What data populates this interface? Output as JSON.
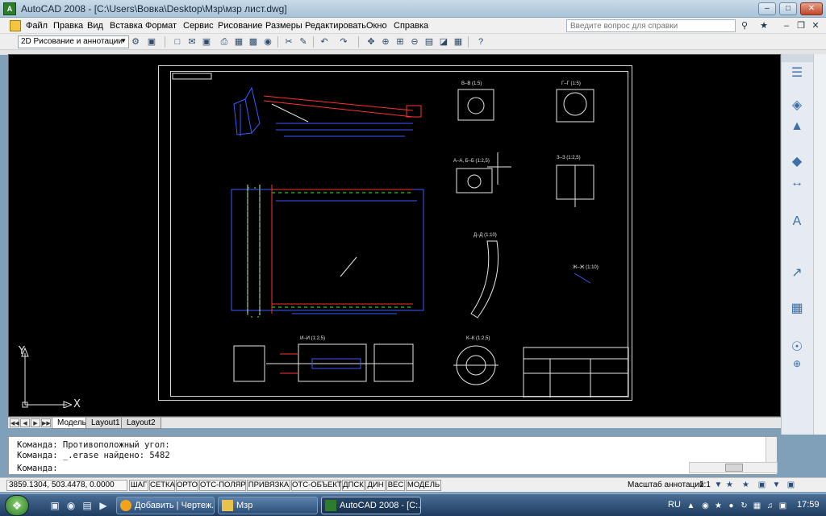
{
  "window": {
    "title": "AutoCAD 2008 - [C:\\Users\\Вовка\\Desktop\\Мзр\\мзр лист.dwg]",
    "app_icon_text": "A"
  },
  "menu": {
    "items": [
      "Файл",
      "Правка",
      "Вид",
      "Вставка",
      "Формат",
      "Сервис",
      "Рисование",
      "Размеры",
      "Редактировать",
      "Окно",
      "Справка"
    ],
    "help_placeholder": "Введите вопрос для справки"
  },
  "toolbar": {
    "workspace": "2D Рисование и аннотации"
  },
  "drawing": {
    "background": "#000000",
    "section_labels": [
      "В–В (1:5)",
      "Г–Г (1:5)",
      "А–А, Б–Б (1:2,5)",
      "З–З (1:2,5)",
      "Д–Д (1:10)",
      "Ж–Ж (1:10)",
      "И–И (1:2,5)",
      "К–К (1:2,5)"
    ],
    "ucs_x": "X",
    "ucs_y": "Y"
  },
  "layout_tabs": [
    "Модель",
    "Layout1",
    "Layout2"
  ],
  "command": {
    "lines": [
      "Команда: Противоположный угол:",
      "Команда: _.erase найдено: 5482",
      "Команда:"
    ]
  },
  "status": {
    "coords": "3859.1304, 503.4478, 0.0000",
    "buttons": [
      "ШАГ",
      "СЕТКА",
      "ОРТО",
      "ОТС-ПОЛЯР",
      "ПРИВЯЗКА",
      "ОТС-ОБЪЕКТ",
      "ДПСК",
      "ДИН",
      "ВЕС",
      "МОДЕЛЬ"
    ],
    "annotation_label": "Масштаб аннотаций:",
    "annotation_value": "1:1"
  },
  "taskbar": {
    "tasks": [
      "Добавить | Чертеж...",
      "Мзр",
      "AutoCAD 2008 - [C:..."
    ],
    "language": "RU",
    "clock": "17:59"
  },
  "colors": {
    "accent_green": "#2d7d2d",
    "cad_blue": "#3a5bff",
    "cad_red": "#ff3030",
    "cad_white": "#e6e6e6"
  }
}
